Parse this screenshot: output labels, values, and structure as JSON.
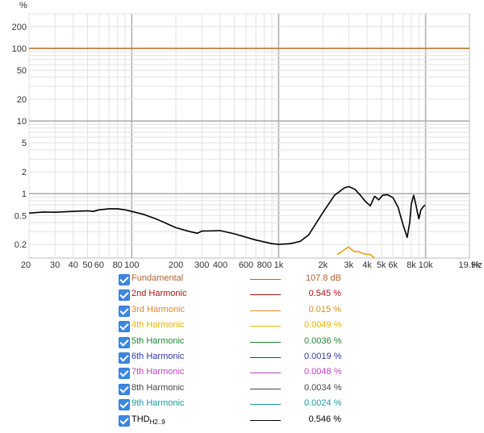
{
  "chart_data": {
    "type": "line",
    "unit_label": "%",
    "xunit_label": "Hz",
    "xscale": "log",
    "yscale": "log",
    "xlim": [
      20,
      19900
    ],
    "ylim": [
      0.13,
      300
    ],
    "grid": true,
    "y_ticks": [
      {
        "v": 200,
        "label": "200"
      },
      {
        "v": 100,
        "label": "100"
      },
      {
        "v": 50,
        "label": "50"
      },
      {
        "v": 20,
        "label": "20"
      },
      {
        "v": 10,
        "label": "10"
      },
      {
        "v": 5,
        "label": "5"
      },
      {
        "v": 2,
        "label": "2"
      },
      {
        "v": 1,
        "label": "1"
      },
      {
        "v": 0.5,
        "label": "0.5"
      },
      {
        "v": 0.2,
        "label": "0.2"
      }
    ],
    "x_ticks": [
      {
        "v": 20,
        "label": "20"
      },
      {
        "v": 30,
        "label": "30"
      },
      {
        "v": 40,
        "label": "40"
      },
      {
        "v": 50,
        "label": "50"
      },
      {
        "v": 60,
        "label": "60"
      },
      {
        "v": 80,
        "label": "80"
      },
      {
        "v": 100,
        "label": "100"
      },
      {
        "v": 200,
        "label": "200"
      },
      {
        "v": 300,
        "label": "300"
      },
      {
        "v": 400,
        "label": "400"
      },
      {
        "v": 600,
        "label": "600"
      },
      {
        "v": 800,
        "label": "800"
      },
      {
        "v": 1000,
        "label": "1k"
      },
      {
        "v": 2000,
        "label": "2k"
      },
      {
        "v": 3000,
        "label": "3k"
      },
      {
        "v": 4000,
        "label": "4k"
      },
      {
        "v": 5000,
        "label": "5k"
      },
      {
        "v": 6000,
        "label": "6k"
      },
      {
        "v": 8000,
        "label": "8k"
      },
      {
        "v": 10000,
        "label": "10k"
      },
      {
        "v": 19900,
        "label": "19.9k"
      }
    ],
    "major_x": [
      100,
      1000,
      10000
    ],
    "major_y": [
      1,
      10,
      100
    ],
    "series": [
      {
        "name": "Fundamental",
        "color": "#c07828",
        "x": [
          20,
          19900
        ],
        "y": [
          100,
          100
        ]
      },
      {
        "name": "3rd Harmonic",
        "color": "#e8a317",
        "x": [
          2500,
          2700,
          2900,
          3000,
          3100,
          3300,
          3500,
          3800,
          4200,
          4500
        ],
        "y": [
          0.145,
          0.16,
          0.178,
          0.185,
          0.173,
          0.158,
          0.16,
          0.148,
          0.145,
          0.13
        ]
      },
      {
        "name": "THD H2..9",
        "color": "#000000",
        "x": [
          20,
          25,
          30,
          40,
          50,
          55,
          60,
          70,
          80,
          90,
          100,
          120,
          150,
          200,
          250,
          280,
          300,
          400,
          500,
          700,
          900,
          1000,
          1200,
          1400,
          1600,
          2000,
          2400,
          2800,
          3000,
          3300,
          3600,
          3900,
          4200,
          4500,
          4800,
          5100,
          5500,
          6000,
          6500,
          7000,
          7500,
          7800,
          8000,
          8300,
          8600,
          8800,
          9000,
          9300,
          9600,
          9900
        ],
        "y": [
          0.54,
          0.56,
          0.555,
          0.57,
          0.58,
          0.57,
          0.6,
          0.62,
          0.62,
          0.6,
          0.57,
          0.52,
          0.44,
          0.34,
          0.3,
          0.285,
          0.305,
          0.31,
          0.28,
          0.23,
          0.205,
          0.2,
          0.205,
          0.22,
          0.27,
          0.55,
          0.95,
          1.2,
          1.25,
          1.15,
          0.95,
          0.78,
          0.68,
          0.92,
          0.82,
          0.95,
          0.97,
          0.88,
          0.65,
          0.38,
          0.25,
          0.4,
          0.72,
          0.95,
          0.7,
          0.55,
          0.45,
          0.6,
          0.65,
          0.7
        ]
      }
    ]
  },
  "legend": [
    {
      "label": "Fundamental",
      "value": "107.8 dB",
      "color": "#b5622e"
    },
    {
      "label": "2nd Harmonic",
      "value": "0.545 %",
      "color": "#b01010"
    },
    {
      "label": "3rd Harmonic",
      "value": "0.015 %",
      "color": "#e08c1a"
    },
    {
      "label": "4th Harmonic",
      "value": "0.0049 %",
      "color": "#e8b400"
    },
    {
      "label": "5th Harmonic",
      "value": "0.0036 %",
      "color": "#1e8a2e"
    },
    {
      "label": "6th Harmonic",
      "value": "0.0019 %",
      "color": "#2a3aa0"
    },
    {
      "label": "7th Harmonic",
      "value": "0.0048 %",
      "color": "#c040c0"
    },
    {
      "label": "8th Harmonic",
      "value": "0.0034 %",
      "color": "#444444"
    },
    {
      "label": "9th Harmonic",
      "value": "0.0024 %",
      "color": "#1a9a9a"
    },
    {
      "label": "THD",
      "label_sub": "H2..9",
      "value": "0.546 %",
      "color": "#000000"
    }
  ]
}
